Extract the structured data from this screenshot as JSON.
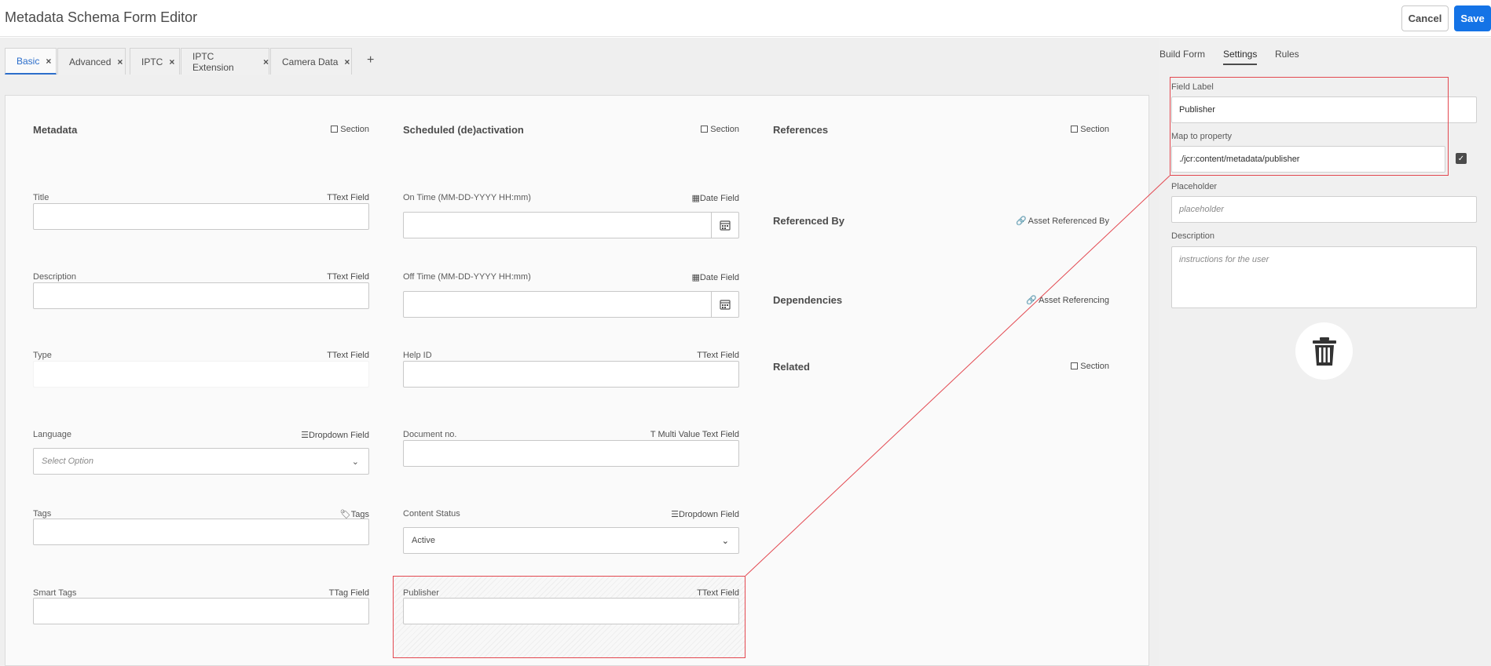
{
  "header": {
    "title": "Metadata Schema Form Editor",
    "cancel_label": "Cancel",
    "save_label": "Save"
  },
  "tabs": [
    {
      "label": "Basic",
      "active": true
    },
    {
      "label": "Advanced"
    },
    {
      "label": "IPTC"
    },
    {
      "label": "IPTC Extension"
    },
    {
      "label": "Camera Data"
    }
  ],
  "add_tab_label": "+",
  "columns": {
    "metadata": {
      "title": "Metadata",
      "type": "Section",
      "fields": [
        {
          "label": "Title",
          "type": "Text Field",
          "value": ""
        },
        {
          "label": "Description",
          "type": "Text Field",
          "value": ""
        },
        {
          "label": "Type",
          "type": "Text Field",
          "value": ""
        },
        {
          "label": "Language",
          "type": "Dropdown Field",
          "placeholder": "Select Option"
        },
        {
          "label": "Tags",
          "type": "Tags",
          "value": ""
        },
        {
          "label": "Smart Tags",
          "type": "Tag Field",
          "value": ""
        }
      ]
    },
    "scheduled": {
      "title": "Scheduled (de)activation",
      "type": "Section",
      "fields": [
        {
          "label": "On Time (MM-DD-YYYY HH:mm)",
          "type": "Date Field",
          "value": ""
        },
        {
          "label": "Off Time (MM-DD-YYYY HH:mm)",
          "type": "Date Field",
          "value": ""
        },
        {
          "label": "Help ID",
          "type": "Text Field",
          "value": ""
        },
        {
          "label": "Document no.",
          "type": "Multi Value Text Field",
          "value": ""
        },
        {
          "label": "Content Status",
          "type": "Dropdown Field",
          "value": "Active"
        },
        {
          "label": "Publisher",
          "type": "Text Field",
          "value": ""
        }
      ]
    },
    "references": {
      "title": "References",
      "type": "Section",
      "groups": [
        {
          "title": "Referenced By",
          "type": "Asset Referenced By"
        },
        {
          "title": "Dependencies",
          "type": "Asset Referencing"
        },
        {
          "title": "Related",
          "type": "Section"
        }
      ]
    }
  },
  "panel": {
    "tabs": [
      "Build Form",
      "Settings",
      "Rules"
    ],
    "active_tab": "Settings",
    "field_label_label": "Field Label",
    "field_label_value": "Publisher",
    "map_label": "Map to property",
    "map_value": "./jcr:content/metadata/publisher",
    "map_checked": true,
    "placeholder_label": "Placeholder",
    "placeholder_placeholder": "placeholder",
    "description_label": "Description",
    "description_placeholder": "instructions for the user"
  },
  "colors": {
    "accent": "#1473e6",
    "active_tab": "#2c6ecb",
    "highlight": "#e34850"
  }
}
